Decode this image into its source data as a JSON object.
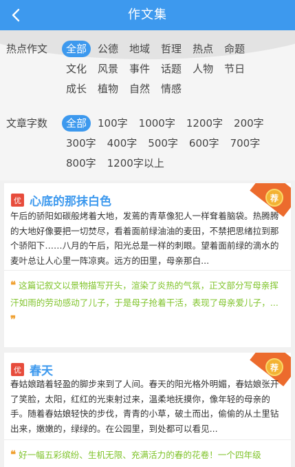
{
  "header": {
    "title": "作文集",
    "back_icon": "chevron-left-icon"
  },
  "filters": {
    "hot": {
      "label": "热点作文",
      "rows": [
        [
          "全部",
          "公德",
          "地域",
          "哲理",
          "热点",
          "命题"
        ],
        [
          "文化",
          "风景",
          "事件",
          "话题",
          "人物",
          "节日"
        ],
        [
          "成长",
          "植物",
          "自然",
          "情感"
        ]
      ],
      "selected": "全部"
    },
    "count": {
      "label": "文章字数",
      "rows": [
        [
          "全部",
          "100字",
          "1000字",
          "1200字",
          "200字"
        ],
        [
          "300字",
          "400字",
          "500字",
          "600字",
          "700字"
        ],
        [
          "800字",
          "1200字以上"
        ]
      ],
      "selected": "全部"
    }
  },
  "articles": [
    {
      "badge": "优",
      "recommend": "荐",
      "title": "心底的那抹白色",
      "excerpt": "午后的骄阳如碳般烤着大地，发蔫的青草像犯人一样耷着脑袋。热腾腾的大地好像要把一切焚尽，看着面前绿油油的麦田，不禁把思绪拉到那个骄阳下……八月的午后，阳光总是一样的刺眼。望着面前绿的滴水的麦叶总让人心里一阵凉爽。远方的田里，母亲那白...",
      "comment": "这篇记叙文以景物描写开头，渲染了炎热的气氛，正文部分写母亲挥汗如雨的劳动感动了儿子，于是母子抢着干活，表现了母亲爱儿子，..."
    },
    {
      "badge": "优",
      "recommend": "荐",
      "title": "春天",
      "excerpt": "春姑娘踏着轻盈的脚步来到了人间。春天的阳光格外明媚，春姑娘张开了笑脸，太阳，红红的光束射过来，温柔地抚摸你，像年轻的母亲的手。随着春姑娘轻快的步伐，青青的小草，破土而出，偷偷的从土里钻出来，嫩嫩的，绿绿的。在公园里，到处都可以看见...",
      "comment": "好一幅五彩缤纷、生机无限、充满活力的春的花卷！一个四年级"
    }
  ],
  "colors": {
    "accent": "#3d99ee",
    "comment": "#7fc32a",
    "ribbon": "#ec6b2d",
    "badge": "#e74c3c"
  }
}
